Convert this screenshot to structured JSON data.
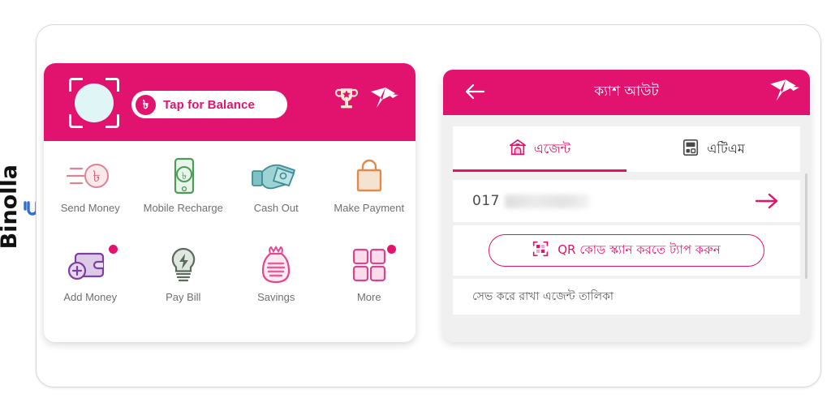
{
  "brand": {
    "name": "Binolla",
    "logo_icon": "binolla-logo-icon",
    "logo_color": "#2f6fd0"
  },
  "theme": {
    "primary": "#e2136e",
    "header_text": "#ffffff",
    "muted_text": "#6f6f6f",
    "panel_bg": "#f0f0f0"
  },
  "left_panel": {
    "name": "bkash-home-screen",
    "header": {
      "avatar_icon": "profile-avatar-icon",
      "scan_frame_icon": "scan-frame-icon",
      "balance_button": {
        "label": "Tap for Balance",
        "currency_icon": "taka-icon",
        "currency_symbol": "৳"
      },
      "trophy_icon": "trophy-icon",
      "logo_icon": "bkash-bird-logo-icon"
    },
    "services": [
      {
        "label": "Send Money",
        "icon": "send-money-icon",
        "badge": false
      },
      {
        "label": "Mobile Recharge",
        "icon": "mobile-recharge-icon",
        "badge": false
      },
      {
        "label": "Cash Out",
        "icon": "cash-out-icon",
        "badge": false
      },
      {
        "label": "Make Payment",
        "icon": "make-payment-icon",
        "badge": false
      },
      {
        "label": "Add Money",
        "icon": "add-money-icon",
        "badge": true
      },
      {
        "label": "Pay Bill",
        "icon": "pay-bill-icon",
        "badge": false
      },
      {
        "label": "Savings",
        "icon": "savings-icon",
        "badge": false
      },
      {
        "label": "More",
        "icon": "more-grid-icon",
        "badge": true
      }
    ]
  },
  "right_panel": {
    "name": "cash-out-screen",
    "header": {
      "back_icon": "back-arrow-icon",
      "title": "ক্যাশ আউট",
      "logo_icon": "bkash-bird-logo-icon"
    },
    "tabs": [
      {
        "label": "এজেন্ট",
        "icon": "agent-icon",
        "active": true
      },
      {
        "label": "এটিএম",
        "icon": "atm-icon",
        "active": false
      }
    ],
    "number_field": {
      "value": "017",
      "masked": true,
      "next_icon": "arrow-right-icon"
    },
    "qr_button": {
      "label": "QR কোড স্ক্যান করতে ট্যাপ করুন",
      "icon": "qr-code-icon"
    },
    "saved_agents_label": "সেভ করে রাখা এজেন্ট তালিকা"
  }
}
